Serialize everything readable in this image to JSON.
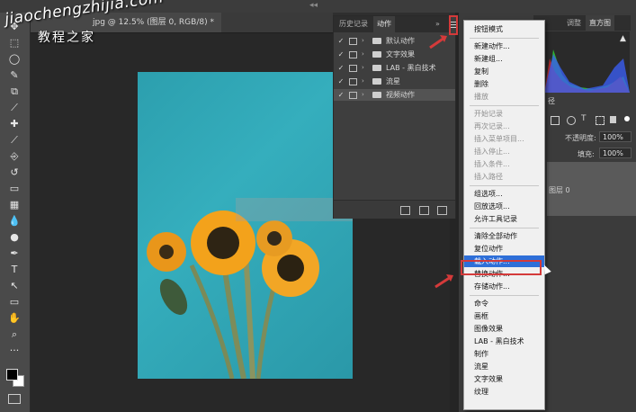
{
  "window": {
    "doc_tab_title": "jpg @ 12.5% (图层 0, RGB/8) *",
    "collapse_glyph": "◂◂"
  },
  "watermark": {
    "latin": "jiaochengzhijia.com",
    "chinese": "教程之家"
  },
  "toolbar": {
    "tools": [
      "move-tool",
      "marquee-tool",
      "lasso-tool",
      "quick-select-tool",
      "crop-tool",
      "eyedropper-tool",
      "spot-heal-tool",
      "brush-tool",
      "stamp-tool",
      "history-brush-tool",
      "eraser-tool",
      "gradient-tool",
      "blur-tool",
      "dodge-tool",
      "pen-tool",
      "type-tool",
      "path-select-tool",
      "shape-tool",
      "hand-tool",
      "zoom-tool",
      "more-tools"
    ],
    "type_glyph": "T",
    "more_glyph": "···"
  },
  "actions_panel": {
    "tabs": [
      "历史记录",
      "动作"
    ],
    "active_tab": "动作",
    "expand_glyph": "»",
    "sets": [
      {
        "label": "默认动作",
        "checked": true
      },
      {
        "label": "文字效果",
        "checked": true
      },
      {
        "label": "LAB - 黑白技术",
        "checked": true
      },
      {
        "label": "流星",
        "checked": true
      },
      {
        "label": "视频动作",
        "checked": true
      }
    ],
    "selected_set": "视频动作",
    "check_glyph": "✓",
    "caret_glyph": "›"
  },
  "right_panel": {
    "tabs": [
      "调整",
      "直方图"
    ],
    "active_tab": "直方图",
    "warning_glyph": "▲",
    "opacity_label": "不透明度:",
    "opacity_value": "100%",
    "fill_label": "填充:",
    "fill_value": "100%",
    "layer_name": "图层 0",
    "section_partial": "径"
  },
  "flyout_menu": {
    "items": [
      {
        "label": "按钮模式",
        "enabled": true
      },
      {
        "sep": true
      },
      {
        "label": "新建动作...",
        "enabled": true
      },
      {
        "label": "新建组...",
        "enabled": true
      },
      {
        "label": "复制",
        "enabled": true
      },
      {
        "label": "删除",
        "enabled": true
      },
      {
        "label": "播放",
        "enabled": false
      },
      {
        "sep": true
      },
      {
        "label": "开始记录",
        "enabled": false
      },
      {
        "label": "再次记录...",
        "enabled": false
      },
      {
        "label": "插入菜单项目...",
        "enabled": false
      },
      {
        "label": "插入停止...",
        "enabled": false
      },
      {
        "label": "插入条件...",
        "enabled": false
      },
      {
        "label": "插入路径",
        "enabled": false
      },
      {
        "sep": true
      },
      {
        "label": "组选项...",
        "enabled": true
      },
      {
        "label": "回放选项...",
        "enabled": true
      },
      {
        "label": "允许工具记录",
        "enabled": true
      },
      {
        "sep": true
      },
      {
        "label": "清除全部动作",
        "enabled": true
      },
      {
        "label": "复位动作",
        "enabled": true
      },
      {
        "label": "载入动作...",
        "enabled": true,
        "highlighted": true
      },
      {
        "label": "替换动作...",
        "enabled": true
      },
      {
        "label": "存储动作...",
        "enabled": true
      },
      {
        "sep": true
      },
      {
        "label": "命令",
        "enabled": true
      },
      {
        "label": "画框",
        "enabled": true
      },
      {
        "label": "图像效果",
        "enabled": true
      },
      {
        "label": "LAB - 黑白技术",
        "enabled": true
      },
      {
        "label": "制作",
        "enabled": true
      },
      {
        "label": "流星",
        "enabled": true
      },
      {
        "label": "文字效果",
        "enabled": true
      },
      {
        "label": "纹理",
        "enabled": true
      }
    ]
  },
  "colors": {
    "accent_highlight": "#2e6fd8",
    "annotation_red": "#d43a3a",
    "canvas_bg": "#282828",
    "photo_bg": "#2f9fad"
  }
}
